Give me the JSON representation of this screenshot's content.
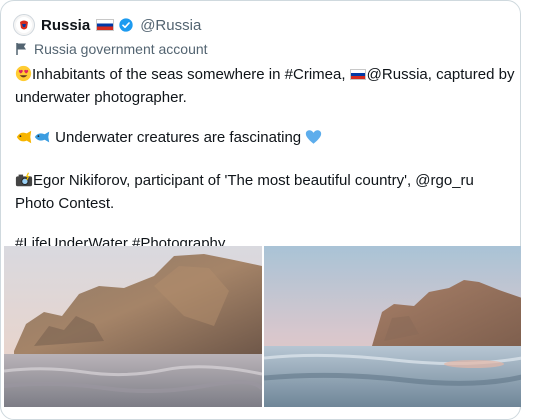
{
  "account": {
    "name": "Russia",
    "handle": "@Russia",
    "label": "Russia government account",
    "verified": true
  },
  "tweet": {
    "line1_text": "Inhabitants of the seas somewhere in #Crimea, ",
    "line1_mention": "@Russia, captured by underwater photographer.",
    "line2_text": " Underwater creatures are fascinating ",
    "line3_text": "Egor Nikiforov, participant of 'The most beautiful country', @rgo_ru Photo Contest.",
    "hashtags": "#LifeUnderWater #Photography"
  },
  "media": {
    "photos": [
      {
        "name": "cliff-sea-photo-left"
      },
      {
        "name": "cliff-sea-photo-right"
      }
    ]
  },
  "colors": {
    "border": "#cfd9de",
    "secondary_text": "#536471",
    "verified_blue": "#1d9bf0",
    "flag_white": "#ffffff",
    "flag_blue": "#0039a6",
    "flag_red": "#d52b1e"
  }
}
